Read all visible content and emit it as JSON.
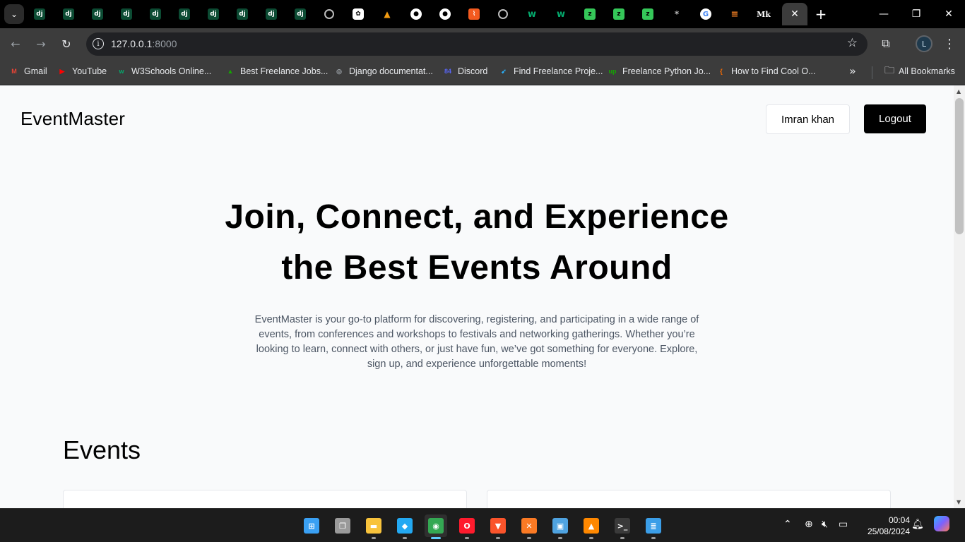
{
  "browser": {
    "tabs": [
      {
        "icon": "django-icon",
        "glyph": "dj"
      },
      {
        "icon": "django-icon",
        "glyph": "dj"
      },
      {
        "icon": "django-icon",
        "glyph": "dj"
      },
      {
        "icon": "django-icon",
        "glyph": "dj"
      },
      {
        "icon": "django-icon",
        "glyph": "dj"
      },
      {
        "icon": "django-icon",
        "glyph": "dj"
      },
      {
        "icon": "django-icon",
        "glyph": "dj"
      },
      {
        "icon": "django-icon",
        "glyph": "dj"
      },
      {
        "icon": "django-icon",
        "glyph": "dj"
      },
      {
        "icon": "django-icon",
        "glyph": "dj"
      },
      {
        "icon": "globe-icon",
        "glyph": ""
      },
      {
        "icon": "chatgpt-icon",
        "glyph": "✿"
      },
      {
        "icon": "xampp-icon",
        "glyph": "▲"
      },
      {
        "icon": "github-icon",
        "glyph": "●"
      },
      {
        "icon": "github-icon",
        "glyph": "●"
      },
      {
        "icon": "orange-app-icon",
        "glyph": "⌇"
      },
      {
        "icon": "globe-icon",
        "glyph": ""
      },
      {
        "icon": "w3schools-icon",
        "glyph": "w"
      },
      {
        "icon": "w3schools-icon",
        "glyph": "w"
      },
      {
        "icon": "green-app-icon",
        "glyph": "z"
      },
      {
        "icon": "green-app-icon",
        "glyph": "z"
      },
      {
        "icon": "green-app-icon",
        "glyph": "z"
      },
      {
        "icon": "star-icon",
        "glyph": "*"
      },
      {
        "icon": "google-icon",
        "glyph": "G"
      },
      {
        "icon": "stackoverflow-icon",
        "glyph": "≡"
      },
      {
        "icon": "medium-icon",
        "glyph": "Mk"
      }
    ],
    "url_host": "127.0.0.1",
    "url_port": ":8000",
    "bookmarks": [
      {
        "label": "Gmail",
        "icon": "gmail-icon",
        "glyph": "M",
        "color": "#ea4335"
      },
      {
        "label": "YouTube",
        "icon": "youtube-icon",
        "glyph": "▶",
        "color": "#ff0000"
      },
      {
        "label": "W3Schools Online...",
        "icon": "w3schools-icon",
        "glyph": "w",
        "color": "#04aa6d"
      },
      {
        "label": "Best Freelance Jobs...",
        "icon": "freelance-icon",
        "glyph": "▲",
        "color": "#14a800"
      },
      {
        "label": "Django documentat...",
        "icon": "globe-icon",
        "glyph": "◎",
        "color": "#9aa0a6"
      },
      {
        "label": "Discord",
        "icon": "discord-icon",
        "glyph": "84",
        "color": "#5865f2"
      },
      {
        "label": "Find Freelance Proje...",
        "icon": "freelancer-icon",
        "glyph": "➶",
        "color": "#29b2fe"
      },
      {
        "label": "Freelance Python Jo...",
        "icon": "upwork-icon",
        "glyph": "up",
        "color": "#14a800"
      },
      {
        "label": "How to Find Cool O...",
        "icon": "bracket-icon",
        "glyph": "{",
        "color": "#ff6d00"
      }
    ],
    "all_bookmarks": "All Bookmarks",
    "profile_initial": "L"
  },
  "site": {
    "brand": "EventMaster",
    "user_button": "Imran khan",
    "logout_button": "Logout",
    "hero_title_line1": "Join, Connect, and Experience",
    "hero_title_line2": "the Best Events Around",
    "hero_description": "EventMaster is your go-to platform for discovering, registering, and participating in a wide range of events, from conferences and workshops to festivals and networking gatherings. Whether you’re looking to learn, connect with others, or just have fun, we’ve got something for everyone. Explore, sign up, and experience unforgettable moments!",
    "events_heading": "Events"
  },
  "taskbar": {
    "apps": [
      {
        "icon": "windows-start-icon",
        "color": "#3aa0f3",
        "active": false
      },
      {
        "icon": "task-view-icon",
        "color": "#9a9a9a",
        "active": false
      },
      {
        "icon": "file-explorer-icon",
        "color": "#f8c33c",
        "active": false
      },
      {
        "icon": "vscode-icon",
        "color": "#23a9f2",
        "active": false
      },
      {
        "icon": "chrome-icon",
        "color": "#34a853",
        "active": true
      },
      {
        "icon": "opera-icon",
        "color": "#ff1b2d",
        "active": false
      },
      {
        "icon": "brave-icon",
        "color": "#fb542b",
        "active": false
      },
      {
        "icon": "xampp-icon",
        "color": "#fb7a24",
        "active": false
      },
      {
        "icon": "control-panel-icon",
        "color": "#4fa3e0",
        "active": false
      },
      {
        "icon": "vlc-icon",
        "color": "#ff8800",
        "active": false
      },
      {
        "icon": "terminal-icon",
        "color": "#3a3a3a",
        "active": false
      },
      {
        "icon": "notepad-icon",
        "color": "#3b9ee8",
        "active": false
      }
    ],
    "time": "00:04",
    "date": "25/08/2024"
  }
}
